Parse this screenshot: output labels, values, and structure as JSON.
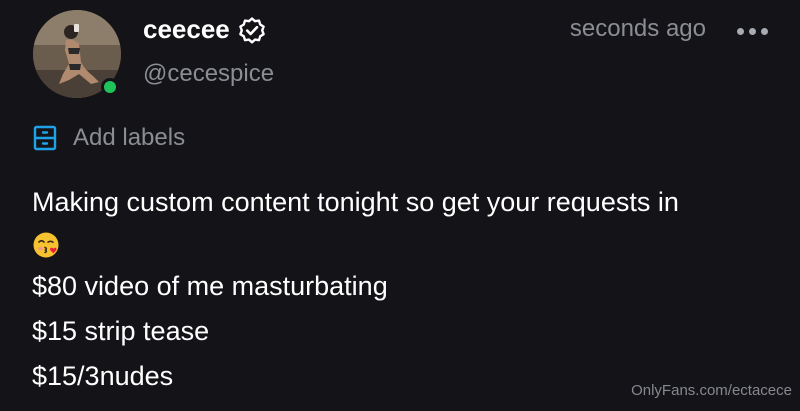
{
  "header": {
    "display_name": "ceecee",
    "handle": "@cecespice",
    "timestamp": "seconds ago",
    "verified_icon": "verified-badge-icon",
    "more_icon": "more-dots-icon",
    "online": true
  },
  "labels": {
    "icon": "labels-icon",
    "text": "Add labels"
  },
  "post": {
    "lines": [
      "Making custom content tonight so get your requests in",
      "$80 video of me masturbating",
      "$15 strip tease",
      "$15/3nudes"
    ],
    "emoji_icon": "face-blowing-kiss-icon"
  },
  "watermark": "OnlyFans.com/ectacece",
  "colors": {
    "background": "#141418",
    "text": "#ffffff",
    "muted": "#8a8d93",
    "accent": "#1fa3e8",
    "online": "#1fc35a"
  }
}
